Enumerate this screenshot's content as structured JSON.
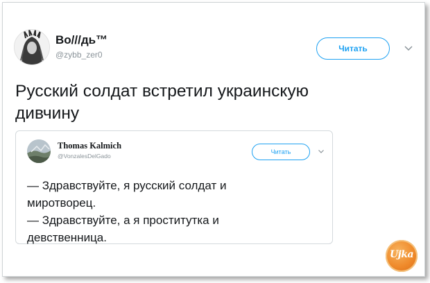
{
  "author": {
    "name": "Bo///дь™",
    "handle": "@zybb_zer0"
  },
  "follow_label": "Читать",
  "tweet_text_line1": "Русский солдат встретил украинскую",
  "tweet_text_line2": "дивчину",
  "quote": {
    "name": "Thomas Kalmich",
    "handle": "@VonzalesDelGado",
    "follow_label": "Читать",
    "lines": [
      "— Здравствуйте, я русский солдат и",
      "миротворец.",
      "— Здравствуйте, а я проститутка и",
      "девственница."
    ]
  },
  "watermark": "Ujka",
  "icons": {
    "more": "chevron-down-icon",
    "avatar": "avatar-icon"
  },
  "colors": {
    "accent": "#1da1f2",
    "text": "#14171a",
    "muted": "#8a9399"
  }
}
